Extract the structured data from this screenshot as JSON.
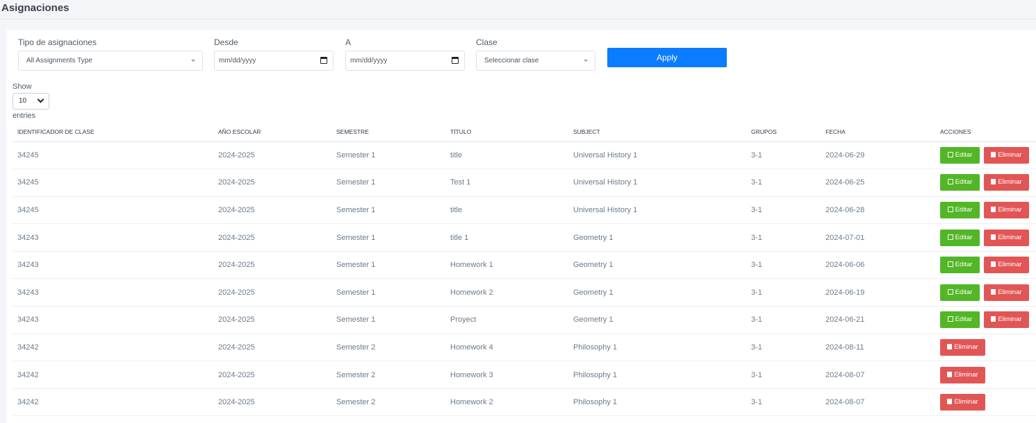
{
  "page": {
    "title": "Asignaciones"
  },
  "filters": {
    "type": {
      "label": "Tipo de asignaciones",
      "value": "All Assignments Type"
    },
    "from": {
      "label": "Desde",
      "placeholder": "mm/dd/yyyy"
    },
    "to": {
      "label": "A",
      "placeholder": "mm/dd/yyyy"
    },
    "class": {
      "label": "Clase",
      "value": "Seleccionar clase"
    },
    "apply_label": "Apply"
  },
  "length": {
    "show_label": "Show",
    "value": "10",
    "entries_label": "entries"
  },
  "table": {
    "headers": [
      "IDENTIFICADOR DE CLASE",
      "AÑO ESCOLAR",
      "SEMESTRE",
      "TÍTULO",
      "SUBJECT",
      "GRUPOS",
      "FECHA",
      "ACCIONES"
    ],
    "edit_label": "Editar",
    "delete_label": "Eliminar",
    "rows": [
      {
        "id": "34245",
        "year": "2024-2025",
        "semester": "Semester 1",
        "title": "title",
        "subject": "Universal History 1",
        "groups": "3-1",
        "date": "2024-06-29",
        "editable": true
      },
      {
        "id": "34245",
        "year": "2024-2025",
        "semester": "Semester 1",
        "title": "Test 1",
        "subject": "Universal History 1",
        "groups": "3-1",
        "date": "2024-06-25",
        "editable": true
      },
      {
        "id": "34245",
        "year": "2024-2025",
        "semester": "Semester 1",
        "title": "title",
        "subject": "Universal History 1",
        "groups": "3-1",
        "date": "2024-06-28",
        "editable": true
      },
      {
        "id": "34243",
        "year": "2024-2025",
        "semester": "Semester 1",
        "title": "title 1",
        "subject": "Geometry 1",
        "groups": "3-1",
        "date": "2024-07-01",
        "editable": true
      },
      {
        "id": "34243",
        "year": "2024-2025",
        "semester": "Semester 1",
        "title": "Homework 1",
        "subject": "Geometry 1",
        "groups": "3-1",
        "date": "2024-06-06",
        "editable": true
      },
      {
        "id": "34243",
        "year": "2024-2025",
        "semester": "Semester 1",
        "title": "Homework 2",
        "subject": "Geometry 1",
        "groups": "3-1",
        "date": "2024-06-19",
        "editable": true
      },
      {
        "id": "34243",
        "year": "2024-2025",
        "semester": "Semester 1",
        "title": "Proyect",
        "subject": "Geometry 1",
        "groups": "3-1",
        "date": "2024-06-21",
        "editable": true
      },
      {
        "id": "34242",
        "year": "2024-2025",
        "semester": "Semester 2",
        "title": "Homework 4",
        "subject": "Philosophy 1",
        "groups": "3-1",
        "date": "2024-08-11",
        "editable": false
      },
      {
        "id": "34242",
        "year": "2024-2025",
        "semester": "Semester 2",
        "title": "Homework 3",
        "subject": "Philosophy 1",
        "groups": "3-1",
        "date": "2024-08-07",
        "editable": false
      },
      {
        "id": "34242",
        "year": "2024-2025",
        "semester": "Semester 2",
        "title": "Homework 2",
        "subject": "Philosophy 1",
        "groups": "3-1",
        "date": "2024-08-07",
        "editable": false
      }
    ]
  },
  "colors": {
    "primary": "#0a7cff",
    "success": "#52b626",
    "danger": "#e25555"
  },
  "icons": {
    "edit": "pencil-square-icon",
    "delete": "trash-icon"
  }
}
